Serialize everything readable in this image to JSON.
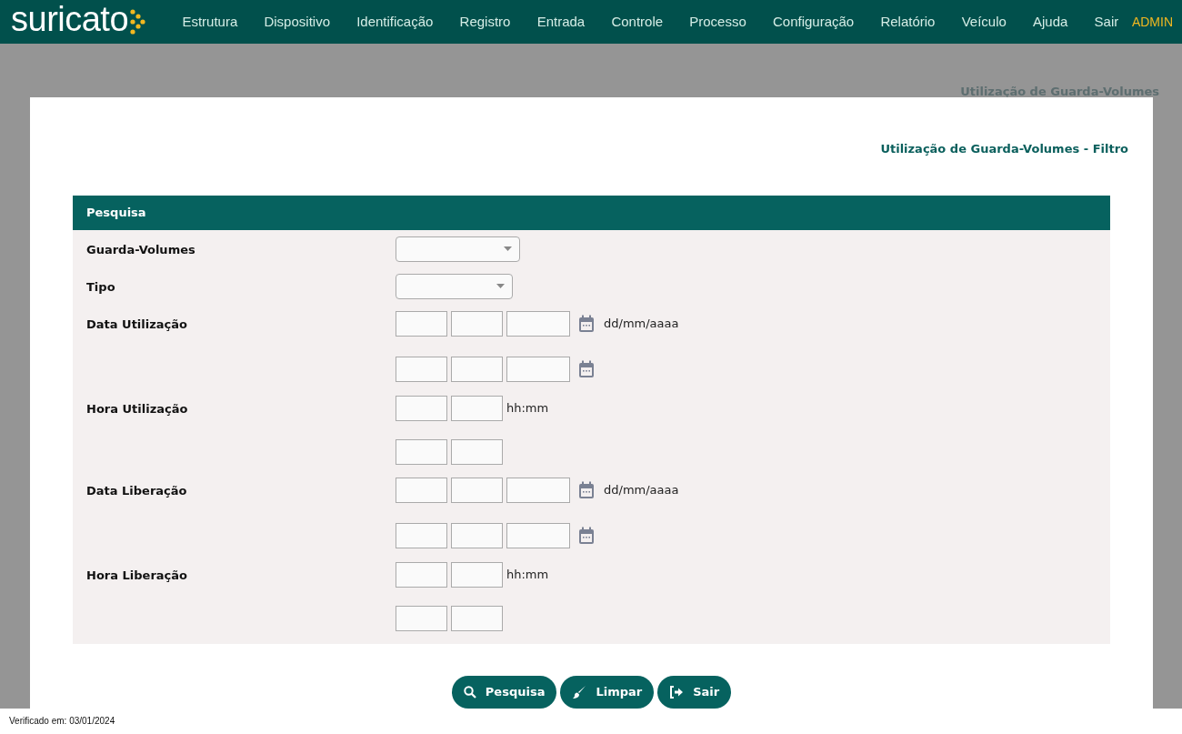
{
  "brand": "suricato",
  "menu": [
    "Estrutura",
    "Dispositivo",
    "Identificação",
    "Registro",
    "Entrada",
    "Controle",
    "Processo",
    "Configuração",
    "Relatório",
    "Veículo",
    "Ajuda",
    "Sair"
  ],
  "user": "ADMIN",
  "breadcrumb": "Utilização de Guarda-Volumes",
  "page_title": "Utilização de Guarda-Volumes - Filtro",
  "panel_title": "Pesquisa",
  "fields": [
    {
      "label": "Guarda-Volumes",
      "kind": "select"
    },
    {
      "label": "Tipo",
      "kind": "select"
    },
    {
      "label": "Data Utilização",
      "kind": "date",
      "hint": "dd/mm/aaaa"
    },
    {
      "kind": "date"
    },
    {
      "label": "Hora Utilização",
      "kind": "time",
      "hint": "hh:mm"
    },
    {
      "kind": "time"
    },
    {
      "label": "Data Liberação",
      "kind": "date",
      "hint": "dd/mm/aaaa"
    },
    {
      "kind": "date"
    },
    {
      "label": "Hora Liberação",
      "kind": "time",
      "hint": "hh:mm"
    },
    {
      "kind": "time"
    }
  ],
  "buttons": [
    {
      "label": "Pesquisa",
      "kind": "search"
    },
    {
      "label": "Limpar",
      "kind": "clear"
    },
    {
      "label": "Sair",
      "kind": "exit"
    }
  ],
  "footer": "Verificado em: 03/01/2024"
}
